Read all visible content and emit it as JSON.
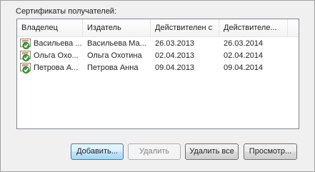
{
  "section_label": "Сертификаты получателей:",
  "columns": [
    "Владелец",
    "Издатель",
    "Действителен с",
    "Действителе..."
  ],
  "rows": [
    {
      "owner": "Васильева ...",
      "issuer": "Васильева Ма...",
      "valid_from": "26.03.2013",
      "valid_to": "26.03.2014"
    },
    {
      "owner": "Ольга Охо...",
      "issuer": "Ольга Охотина",
      "valid_from": "02.04.2013",
      "valid_to": "02.04.2014"
    },
    {
      "owner": "Петрова А...",
      "issuer": "Петрова Анна",
      "valid_from": "09.04.2013",
      "valid_to": "09.04.2014"
    }
  ],
  "buttons": {
    "add": "Добавить...",
    "remove": "Удалить",
    "remove_all": "Удалить все",
    "view": "Просмотр..."
  },
  "icon": "certificate-check-icon"
}
